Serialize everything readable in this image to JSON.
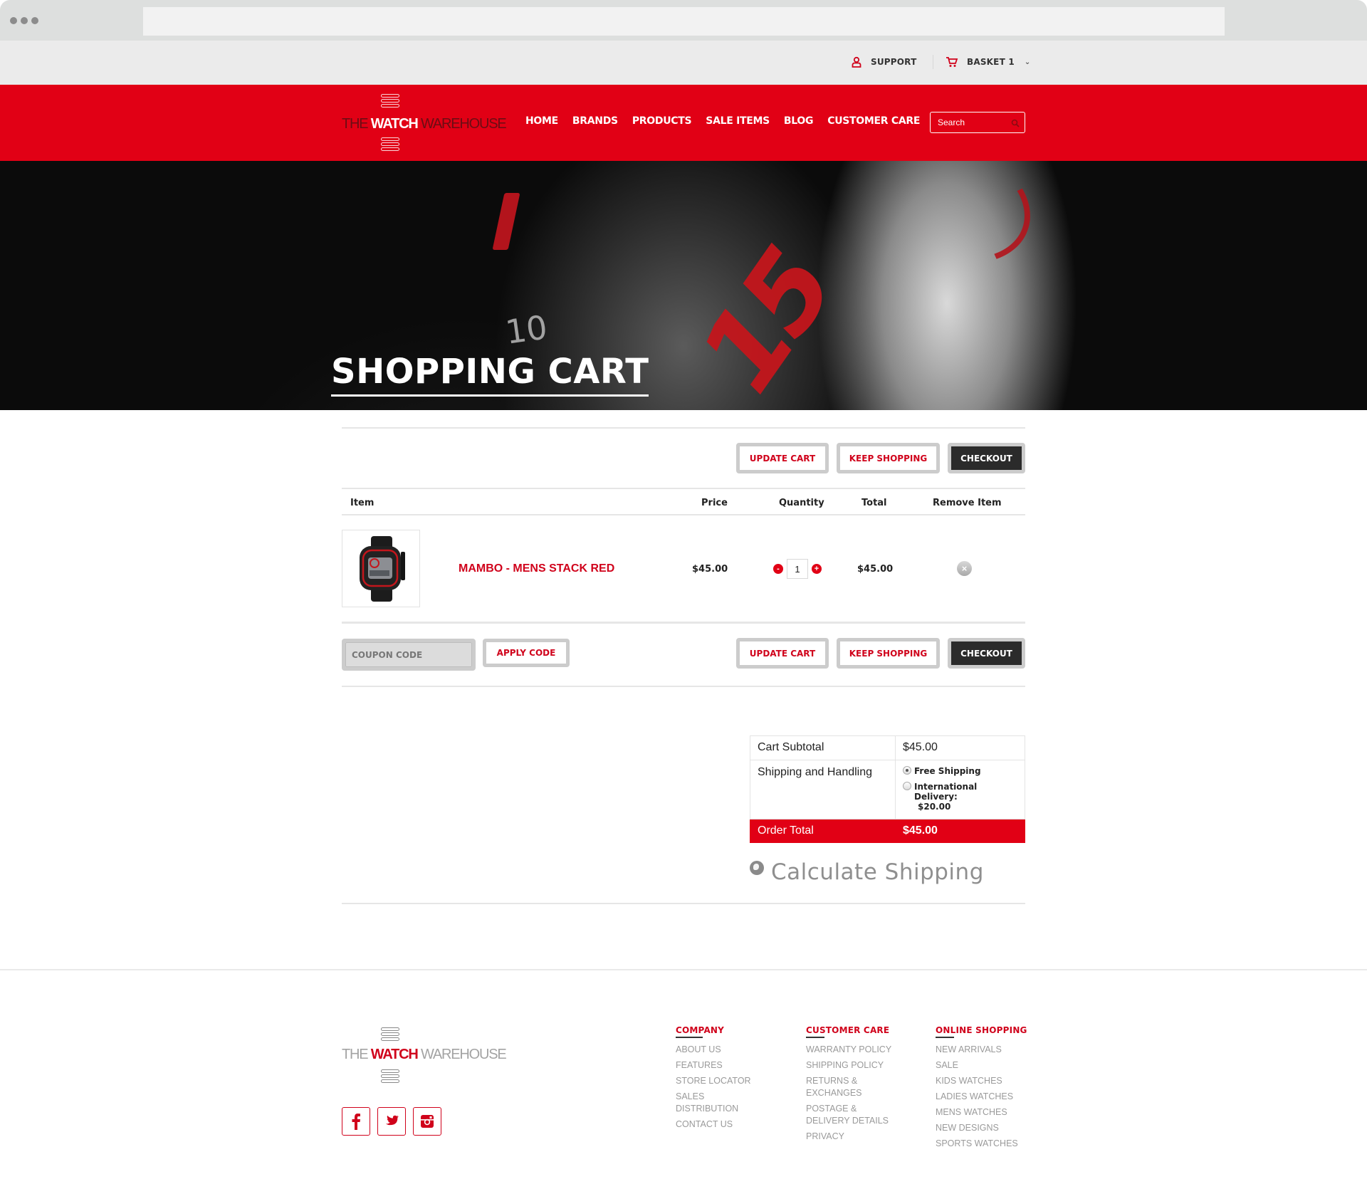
{
  "colors": {
    "brand_red": "#e10015",
    "dark_button": "#2b2b2b",
    "muted_text": "#9a9a9a"
  },
  "utility_bar": {
    "support_label": "SUPPORT",
    "basket_label": "BASKET 1",
    "support_icon": "user-icon",
    "basket_icon": "cart-icon"
  },
  "header": {
    "logo": {
      "part1": "THE ",
      "part2": "WATCH",
      "part3": " WAREHOUSE"
    },
    "nav": [
      {
        "label": "HOME"
      },
      {
        "label": "BRANDS"
      },
      {
        "label": "PRODUCTS"
      },
      {
        "label": "SALE ITEMS"
      },
      {
        "label": "BLOG"
      },
      {
        "label": "CUSTOMER CARE"
      }
    ],
    "search": {
      "placeholder": "Search",
      "value": ""
    }
  },
  "hero": {
    "title": "SHOPPING CART",
    "numeral": "15",
    "dial_text": "10"
  },
  "cart": {
    "buttons": {
      "update": "UPDATE CART",
      "keep_shopping": "KEEP SHOPPING",
      "checkout": "CHECKOUT"
    },
    "columns": {
      "item": "Item",
      "price": "Price",
      "quantity": "Quantity",
      "total": "Total",
      "remove": "Remove Item"
    },
    "items": [
      {
        "name": "MAMBO - MENS STACK RED",
        "price": "$45.00",
        "quantity": "1",
        "total": "$45.00",
        "minus": "-",
        "plus": "+",
        "remove": "×"
      }
    ],
    "coupon": {
      "placeholder": "COUPON CODE",
      "value": "",
      "apply_label": "APPLY CODE"
    }
  },
  "totals": {
    "subtotal_label": "Cart Subtotal",
    "subtotal_value": "$45.00",
    "shipping_label": "Shipping and Handling",
    "shipping_options": [
      {
        "label": "Free Shipping",
        "price": "",
        "selected": true
      },
      {
        "label": "International Delivery:",
        "price": "$20.00",
        "selected": false
      }
    ],
    "order_total_label": "Order Total",
    "order_total_value": "$45.00",
    "calculate_shipping": "Calculate Shipping"
  },
  "footer": {
    "logo": {
      "part1": "THE ",
      "part2": "WATCH",
      "part3": " WAREHOUSE"
    },
    "social": [
      "facebook",
      "twitter",
      "instagram"
    ],
    "columns": [
      {
        "title": "COMPANY",
        "links": [
          "ABOUT US",
          "FEATURES",
          "STORE LOCATOR",
          "SALES DISTRIBUTION",
          "CONTACT US"
        ]
      },
      {
        "title": "CUSTOMER CARE",
        "links": [
          "WARRANTY POLICY",
          "SHIPPING POLICY",
          "RETURNS & EXCHANGES",
          "POSTAGE & DELIVERY DETAILS",
          "PRIVACY"
        ]
      },
      {
        "title": "ONLINE SHOPPING",
        "links": [
          "NEW ARRIVALS",
          "SALE",
          "KIDS WATCHES",
          "LADIES WATCHES",
          "MENS WATCHES",
          "NEW DESIGNS",
          "SPORTS WATCHES"
        ]
      }
    ]
  }
}
